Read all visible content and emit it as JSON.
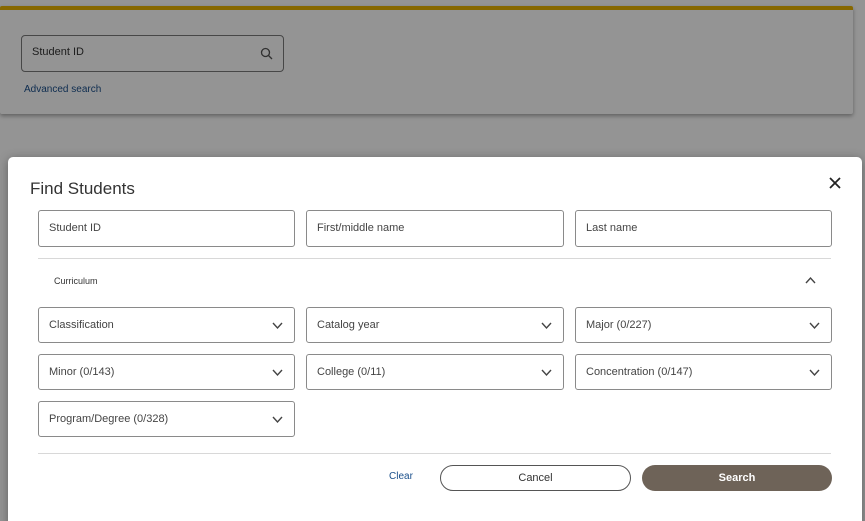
{
  "background": {
    "search": {
      "placeholder": "Student ID",
      "icon": "search-icon"
    },
    "advanced_search_label": "Advanced search",
    "accent_color": "#e8b400"
  },
  "modal": {
    "title": "Find Students",
    "close_icon": "close-icon",
    "name_fields": [
      {
        "label": "Student ID"
      },
      {
        "label": "First/middle name"
      },
      {
        "label": "Last name"
      }
    ],
    "curriculum": {
      "label": "Curriculum",
      "collapse_icon": "chevron-up-icon",
      "dropdowns": [
        {
          "label": "Classification"
        },
        {
          "label": "Catalog year"
        },
        {
          "label": "Major (0/227)"
        },
        {
          "label": "Minor (0/143)"
        },
        {
          "label": "College (0/11)"
        },
        {
          "label": "Concentration (0/147)"
        },
        {
          "label": "Program/Degree (0/328)"
        }
      ]
    },
    "actions": {
      "clear_label": "Clear",
      "cancel_label": "Cancel",
      "search_label": "Search",
      "search_color": "#6e6358"
    }
  }
}
